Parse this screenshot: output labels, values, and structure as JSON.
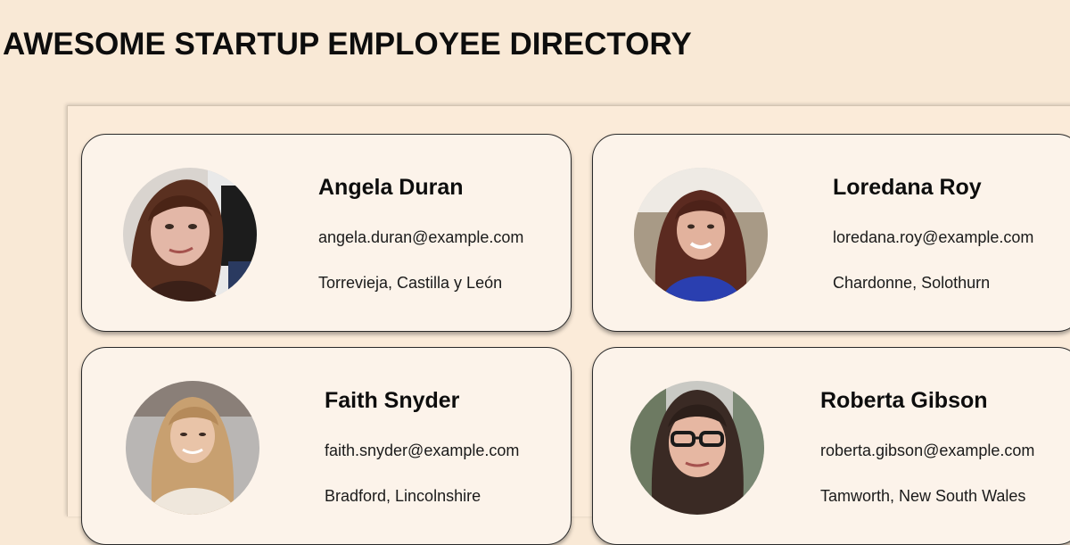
{
  "header": {
    "title": "AWESOME STARTUP EMPLOYEE DIRECTORY"
  },
  "employees": [
    {
      "name": "Angela Duran",
      "email": "angela.duran@example.com",
      "location": "Torrevieja, Castilla y León",
      "avatar_icon": "person-photo",
      "accent": "#5a3020"
    },
    {
      "name": "Loredana Roy",
      "email": "loredana.roy@example.com",
      "location": "Chardonne, Solothurn",
      "avatar_icon": "person-photo",
      "accent": "#2a3fb0"
    },
    {
      "name": "Faith Snyder",
      "email": "faith.snyder@example.com",
      "location": "Bradford, Lincolnshire",
      "avatar_icon": "person-photo",
      "accent": "#c8a070"
    },
    {
      "name": "Roberta Gibson",
      "email": "roberta.gibson@example.com",
      "location": "Tamworth, New South Wales",
      "avatar_icon": "person-photo",
      "accent": "#3a2a24"
    }
  ],
  "colors": {
    "page_background": "#f9e9d6",
    "card_background": "#fcf3ea",
    "text": "#111111"
  }
}
